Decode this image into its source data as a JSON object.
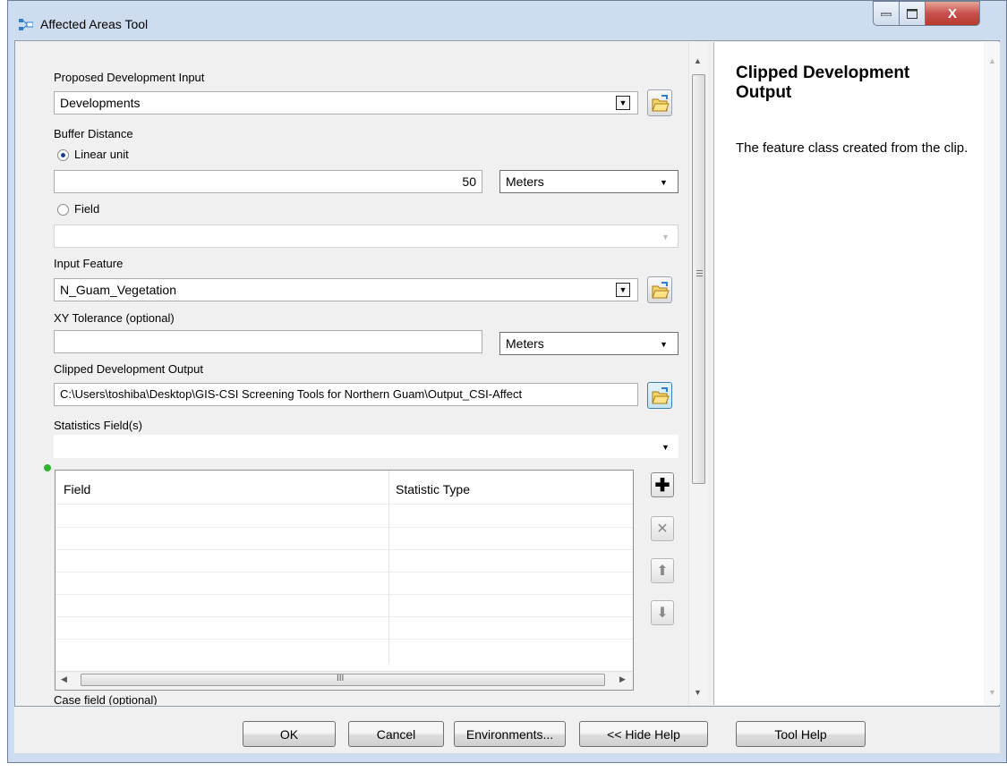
{
  "window": {
    "title": "Affected Areas Tool",
    "close_label": "X"
  },
  "form": {
    "proposed_dev_label": "Proposed Development Input",
    "proposed_dev_value": "Developments",
    "buffer_label": "Buffer Distance",
    "linear_unit_label": "Linear unit",
    "linear_unit_value": "50",
    "linear_unit_units": "Meters",
    "field_label": "Field",
    "field_value": "",
    "input_feature_label": "Input Feature",
    "input_feature_value": "N_Guam_Vegetation",
    "xy_tolerance_label": "XY Tolerance (optional)",
    "xy_tolerance_value": "",
    "xy_tolerance_units": "Meters",
    "clipped_output_label": "Clipped Development Output",
    "clipped_output_value": "C:\\Users\\toshiba\\Desktop\\GIS-CSI Screening Tools for Northern Guam\\Output_CSI-Affect",
    "statistics_label": "Statistics Field(s)",
    "statistics_value": "",
    "case_field_label": "Case field (optional)"
  },
  "grid": {
    "columns": [
      "Field",
      "Statistic Type"
    ],
    "rows": 6,
    "scroll_center": "III"
  },
  "help": {
    "title": "Clipped Development Output",
    "body": "The feature class created from the clip."
  },
  "buttons": {
    "ok": "OK",
    "cancel": "Cancel",
    "environments": "Environments...",
    "hide_help": "<< Hide Help",
    "tool_help": "Tool Help"
  },
  "colors": {
    "title_bar": "#cddcee",
    "close_button": "#c75050",
    "required_dot": "#2fb52f"
  }
}
